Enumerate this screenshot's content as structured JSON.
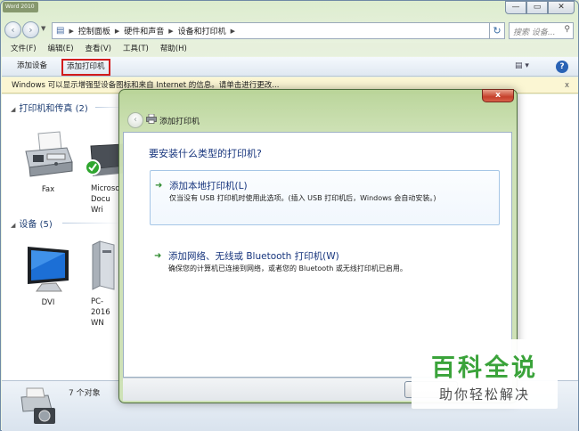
{
  "window": {
    "title_overlay": "Word 2010",
    "btn_min": "—",
    "btn_max": "▭",
    "btn_close": "✕"
  },
  "address": {
    "crumbs": [
      "控制面板",
      "硬件和声音",
      "设备和打印机"
    ],
    "search_placeholder": "搜索 设备..."
  },
  "menu": [
    "文件(F)",
    "编辑(E)",
    "查看(V)",
    "工具(T)",
    "帮助(H)"
  ],
  "toolbar": {
    "add_device": "添加设备",
    "add_printer": "添加打印机"
  },
  "infobar": {
    "text": "Windows 可以显示增强型设备图标和来自 Internet 的信息。请单击进行更改...",
    "close": "x"
  },
  "groups": {
    "printers": {
      "label": "打印机和传真 (2)"
    },
    "devices": {
      "label": "设备 (5)"
    }
  },
  "printer_items": [
    {
      "label": "Fax"
    },
    {
      "label": "Microso Docu Wri"
    }
  ],
  "device_items": [
    {
      "label": "DVI"
    },
    {
      "label": "PC-2016 WN"
    }
  ],
  "status": {
    "count": "7 个对象"
  },
  "dialog": {
    "title": "添加打印机",
    "close": "x",
    "question": "要安装什么类型的打印机?",
    "option_local": {
      "title": "添加本地打印机(L)",
      "desc": "仅当没有 USB 打印机时使用此选项。(插入 USB 打印机后，Windows 会自动安装。)"
    },
    "option_network": {
      "title": "添加网络、无线或 Bluetooth 打印机(W)",
      "desc": "确保您的计算机已连接到网络，或者您的 Bluetooth 或无线打印机已启用。"
    }
  },
  "watermark": {
    "big": "百科全说",
    "small": "助你轻松解决"
  }
}
